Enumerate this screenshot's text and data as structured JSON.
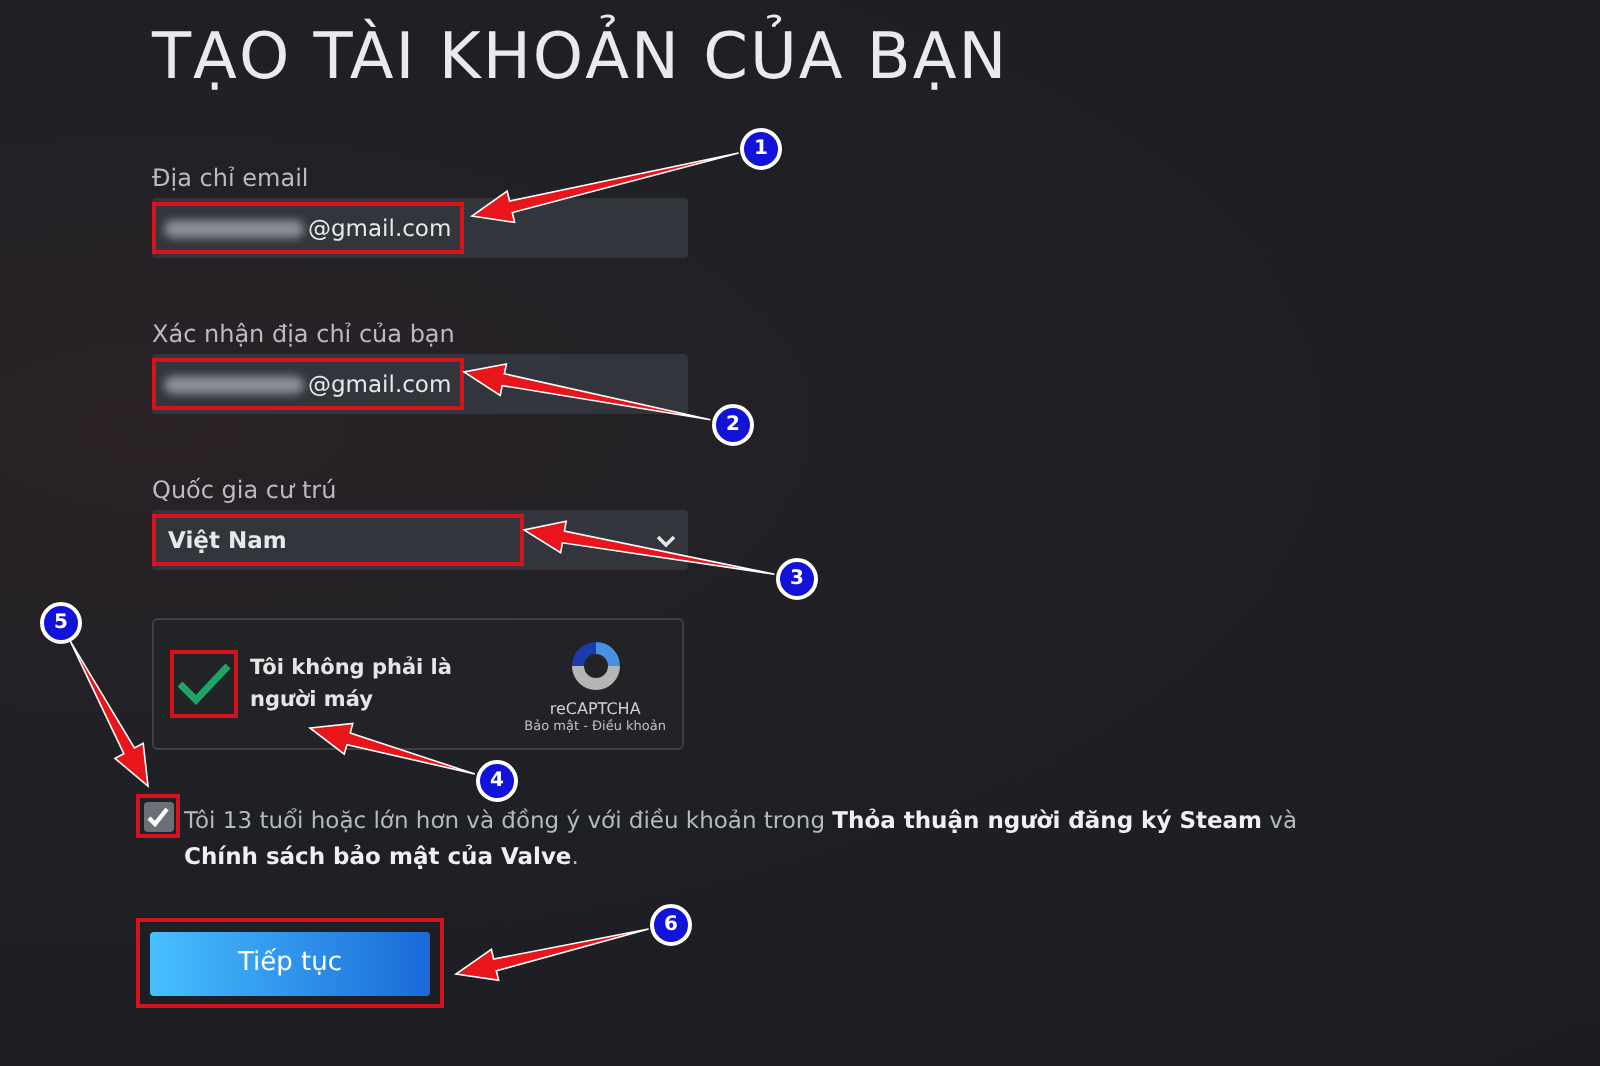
{
  "title": "TẠO TÀI KHOẢN CỦA BẠN",
  "fields": [
    {
      "kind": "text",
      "label": "Địa chỉ email",
      "value": "@gmail.com",
      "redacted": true,
      "highlighted": true
    },
    {
      "kind": "text",
      "label": "Xác nhận địa chỉ của bạn",
      "value": "@gmail.com",
      "redacted": true,
      "highlighted": true
    },
    {
      "kind": "select",
      "label": "Quốc gia cư trú",
      "value": "Việt Nam",
      "highlighted": true
    }
  ],
  "captcha": {
    "checked": true,
    "highlighted": true,
    "label": "Tôi không phải là người máy",
    "brand": "reCAPTCHA",
    "links": "Bảo mật - Điều khoản"
  },
  "agreement": {
    "checked": true,
    "highlighted": true,
    "text": "Tôi 13 tuổi hoặc lớn hơn và đồng ý với điều khoản trong **Thỏa thuận người đăng ký Steam** và **Chính sách bảo mật của Valve**."
  },
  "button": {
    "label": "Tiếp tục",
    "highlighted": true
  },
  "annotations": [
    {
      "number": "1"
    },
    {
      "number": "2"
    },
    {
      "number": "3"
    },
    {
      "number": "4"
    },
    {
      "number": "5"
    },
    {
      "number": "6"
    }
  ]
}
